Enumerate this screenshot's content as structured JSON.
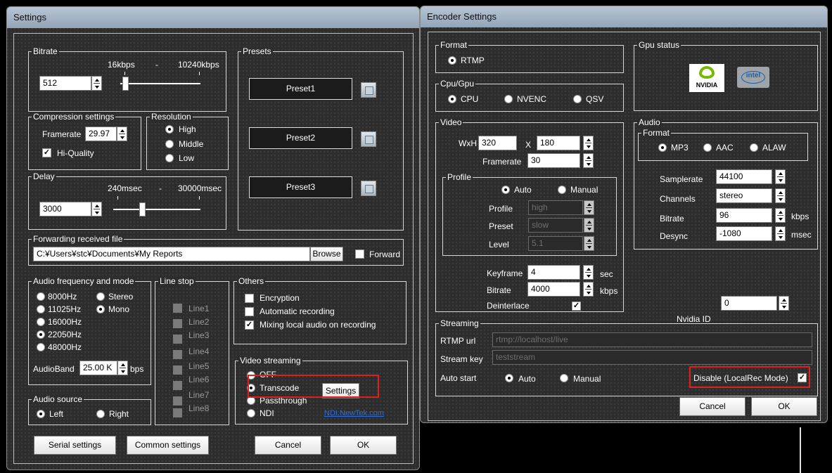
{
  "settings": {
    "title": "Settings",
    "bitrate": {
      "label": "Bitrate",
      "min_label": "16kbps",
      "dash": "-",
      "max_label": "10240kbps",
      "value": "512",
      "slider_fraction": 0.05
    },
    "presets": {
      "label": "Presets",
      "items": [
        "Preset1",
        "Preset2",
        "Preset3"
      ]
    },
    "compression": {
      "label": "Compression settings",
      "framerate_label": "Framerate",
      "framerate_value": "29.97",
      "hiquality_label": "Hi-Quality",
      "hiquality_checked": true
    },
    "resolution": {
      "label": "Resolution",
      "options": [
        "High",
        "Middle",
        "Low"
      ],
      "selected": "High"
    },
    "delay": {
      "label": "Delay",
      "min_label": "240msec",
      "dash": "-",
      "max_label": "30000msec",
      "value": "3000",
      "slider_fraction": 0.3
    },
    "forwarding": {
      "label": "Forwarding received file",
      "path": "C:¥Users¥stc¥Documents¥My Reports",
      "browse_label": "Browse",
      "forward_label": "Forward",
      "forward_checked": false
    },
    "audio_freq": {
      "label": "Audio frequency and mode",
      "freqs": [
        "8000Hz",
        "11025Hz",
        "16000Hz",
        "22050Hz",
        "48000Hz"
      ],
      "selected_freq": "22050Hz",
      "modes": [
        "Stereo",
        "Mono"
      ],
      "selected_mode": "Mono",
      "audioband_label": "AudioBand",
      "audioband_value": "25.00 K",
      "audioband_unit": "bps"
    },
    "line_stop": {
      "label": "Line stop",
      "lines": [
        "Line1",
        "Line2",
        "Line3",
        "Line4",
        "Line5",
        "Line6",
        "Line7",
        "Line8"
      ]
    },
    "others": {
      "label": "Others",
      "items": [
        {
          "label": "Encryption",
          "checked": false
        },
        {
          "label": "Automatic recording",
          "checked": false
        },
        {
          "label": "Mixing local audio on recording",
          "checked": true
        }
      ]
    },
    "video_streaming": {
      "label": "Video streaming",
      "options": [
        "OFF",
        "Transcode",
        "Passthrough",
        "NDI"
      ],
      "selected": "Transcode",
      "settings_label": "Settings",
      "ndi_link": "NDI.NewTek.com"
    },
    "audio_source": {
      "label": "Audio source",
      "options": [
        "Left",
        "Right"
      ],
      "selected": "Left"
    },
    "buttons": {
      "serial": "Serial settings",
      "common": "Common settings",
      "cancel": "Cancel",
      "ok": "OK"
    }
  },
  "encoder": {
    "title": "Encoder Settings",
    "format": {
      "label": "Format",
      "option": "RTMP",
      "selected": true
    },
    "cpu_gpu": {
      "label": "Cpu/Gpu",
      "options": [
        "CPU",
        "NVENC",
        "QSV"
      ],
      "selected": "CPU"
    },
    "gpu_status": {
      "label": "Gpu status",
      "nvidia_text": "NVIDIA",
      "intel_text": "intel"
    },
    "video": {
      "label": "Video",
      "wxh_label": "WxH",
      "width": "320",
      "x_label": "X",
      "height": "180",
      "framerate_label": "Framerate",
      "framerate": "30",
      "profile_group": {
        "label": "Profile",
        "modes": [
          "Auto",
          "Manual"
        ],
        "selected": "Auto",
        "profile_label": "Profile",
        "profile_value": "high",
        "preset_label": "Preset",
        "preset_value": "slow",
        "level_label": "Level",
        "level_value": "5.1"
      },
      "keyframe_label": "Keyframe",
      "keyframe": "4",
      "keyframe_unit": "sec",
      "bitrate_label": "Bitrate",
      "bitrate": "4000",
      "bitrate_unit": "kbps",
      "deinterlace_label": "Deinterlace",
      "deinterlace_checked": true
    },
    "audio": {
      "label": "Audio",
      "format_label": "Format",
      "formats": [
        "MP3",
        "AAC",
        "ALAW"
      ],
      "selected_format": "MP3",
      "samplerate_label": "Samplerate",
      "samplerate": "44100",
      "channels_label": "Channels",
      "channels": "stereo",
      "bitrate_label": "Bitrate",
      "bitrate": "96",
      "bitrate_unit": "kbps",
      "desync_label": "Desync",
      "desync": "-1080",
      "desync_unit": "msec"
    },
    "nvidia_id_label": "Nvidia ID",
    "nvidia_id": "0",
    "streaming": {
      "label": "Streaming",
      "rtmp_label": "RTMP url",
      "rtmp_value": "rtmp://localhost/live",
      "key_label": "Stream key",
      "key_value": "teststream",
      "autostart_label": "Auto start",
      "autostart_options": [
        "Auto",
        "Manual"
      ],
      "autostart_selected": "Auto",
      "disable_label": "Disable (LocalRec Mode)",
      "disable_checked": true
    },
    "buttons": {
      "cancel": "Cancel",
      "ok": "OK"
    }
  }
}
